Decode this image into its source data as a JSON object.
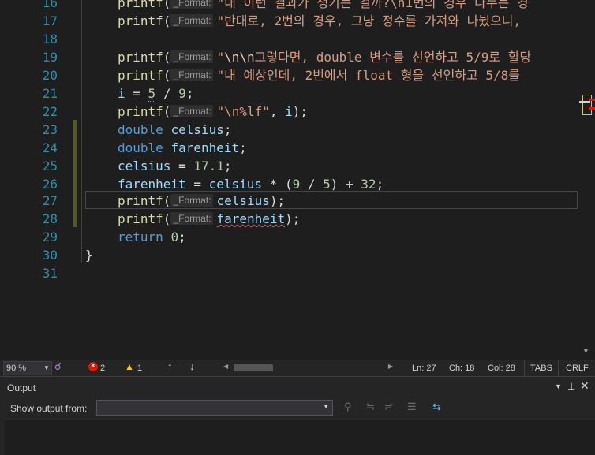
{
  "editor": {
    "lines": [
      {
        "num": "16"
      },
      {
        "num": "17"
      },
      {
        "num": "18"
      },
      {
        "num": "19"
      },
      {
        "num": "20"
      },
      {
        "num": "21"
      },
      {
        "num": "22"
      },
      {
        "num": "23"
      },
      {
        "num": "24"
      },
      {
        "num": "25"
      },
      {
        "num": "26"
      },
      {
        "num": "27"
      },
      {
        "num": "28"
      },
      {
        "num": "29"
      },
      {
        "num": "30"
      },
      {
        "num": "31"
      }
    ],
    "hint_label": "_Format:",
    "tokens": {
      "printf": "printf",
      "paren_open": "(",
      "l16_str": "\"내 이런 결과가 생기는 걸까?\\n1번의 경우 나누는 경",
      "l17_str": "\"반대로, 2번의 경우, 그냥 정수를 가져와 나눴으니,",
      "l19_esc": "\\n\\n",
      "l19_str": "그렇다면, double 변수를 선언하고 5/9로 할당",
      "l20_str": "\"내 예상인데, 2번에서 float 형을 선언하고 5/8를",
      "l21_i": "i",
      "l21_eq": " = ",
      "l21_5": "5",
      "l21_div": " / ",
      "l21_9": "9",
      "semi": ";",
      "l22_str": "\"\\n%lf\"",
      "l22_rest": ", ",
      "l22_i": "i",
      "close_semi": ");",
      "double": "double",
      "celsius": "celsius",
      "farenheit": "farenheit",
      "l25_rest": " = ",
      "l25_num": "17.1",
      "l26_mid": " = ",
      "l26_op1": " * (",
      "l26_9": "9",
      "l26_div": " / ",
      "l26_5": "5",
      "l26_op2": ") + ",
      "l26_32": "32",
      "return": "return",
      "zero": "0",
      "brace": "}",
      "quote_open": "\"",
      "space": " "
    }
  },
  "statusbar": {
    "zoom": "90 %",
    "errors": "2",
    "warnings": "1",
    "up_arrow": "↑",
    "down_arrow": "↓",
    "ln": "Ln: 27",
    "ch": "Ch: 18",
    "col": "Col: 28",
    "tabs": "TABS",
    "crlf": "CRLF"
  },
  "output": {
    "title": "Output",
    "show_from_label": "Show output from:",
    "show_from_value": ""
  },
  "colors": {
    "error": "#e51400",
    "warning": "#ffcc00",
    "line_number": "#2b91af"
  },
  "icons": [
    "health-icon",
    "error-icon",
    "warning-icon",
    "dropdown-icon",
    "pin-icon",
    "close-icon",
    "word-wrap-icon"
  ]
}
